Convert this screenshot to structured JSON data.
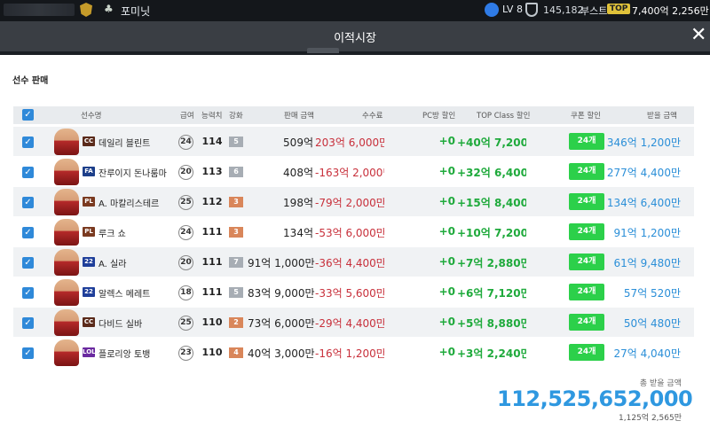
{
  "topbar": {
    "team_name": "포미닛",
    "level": "LV 8",
    "points": "145,182",
    "boost_label": "부스트",
    "top_badge": "TOP",
    "money": "7,400억 2,256만"
  },
  "window": {
    "title": "이적시장"
  },
  "section_title": "선수 판매",
  "columns": {
    "name": "선수명",
    "salary": "급여",
    "ovr": "능력치",
    "enhance": "강화",
    "price": "판매 금액",
    "fee": "수수료",
    "pc_discount": "PC방 할인",
    "topclass_discount": "TOP Class 할인",
    "coupon_discount": "쿠폰 할인",
    "receive": "받을 금액"
  },
  "colors": {
    "accent_blue": "#2f89d9",
    "fee_red": "#c8303b",
    "discount_green": "#1faa3c",
    "coupon_green": "#2cd04a"
  },
  "players": [
    {
      "season": "CC",
      "season_color": "#5a2a1a",
      "name": "데일리 블린트",
      "salary": "24",
      "ovr": "114",
      "enhance": "5",
      "enhance_color": "#a7adb4",
      "price": "509억",
      "fee": "203억 6,000만",
      "pc": "+0",
      "topclass": "+40억 7,200만",
      "coupon": "24개",
      "receive": "346억 1,200만"
    },
    {
      "season": "FA",
      "season_color": "#1d3f8a",
      "name": "잔루이지 돈나룸마",
      "salary": "20",
      "ovr": "113",
      "enhance": "6",
      "enhance_color": "#a7adb4",
      "price": "408억",
      "fee": "-163억 2,000만",
      "pc": "+0",
      "topclass": "+32억 6,400만",
      "coupon": "24개",
      "receive": "277억 4,400만"
    },
    {
      "season": "PL",
      "season_color": "#7a3a20",
      "name": "A. 마칼리스테르",
      "salary": "25",
      "ovr": "112",
      "enhance": "3",
      "enhance_color": "#d9865a",
      "price": "198억",
      "fee": "-79억 2,000만",
      "pc": "+0",
      "topclass": "+15억 8,400만",
      "coupon": "24개",
      "receive": "134억 6,400만"
    },
    {
      "season": "PL",
      "season_color": "#7a3a20",
      "name": "루크 쇼",
      "salary": "24",
      "ovr": "111",
      "enhance": "3",
      "enhance_color": "#d9865a",
      "price": "134억",
      "fee": "-53억 6,000만",
      "pc": "+0",
      "topclass": "+10억 7,200만",
      "coupon": "24개",
      "receive": "91억 1,200만"
    },
    {
      "season": "22",
      "season_color": "#1f3f9a",
      "name": "A. 실라",
      "salary": "20",
      "ovr": "111",
      "enhance": "7",
      "enhance_color": "#a7adb4",
      "price": "91억 1,000만",
      "fee": "-36억 4,400만",
      "pc": "+0",
      "topclass": "+7억 2,880만",
      "coupon": "24개",
      "receive": "61억 9,480만"
    },
    {
      "season": "22",
      "season_color": "#1f3f9a",
      "name": "알렉스 메레트",
      "salary": "18",
      "ovr": "111",
      "enhance": "5",
      "enhance_color": "#a7adb4",
      "price": "83억 9,000만",
      "fee": "-33억 5,600만",
      "pc": "+0",
      "topclass": "+6억 7,120만",
      "coupon": "24개",
      "receive": "57억 520만"
    },
    {
      "season": "CC",
      "season_color": "#5a2a1a",
      "name": "다비드 실바",
      "salary": "25",
      "ovr": "110",
      "enhance": "2",
      "enhance_color": "#d9865a",
      "price": "73억 6,000만",
      "fee": "-29억 4,400만",
      "pc": "+0",
      "topclass": "+5억 8,880만",
      "coupon": "24개",
      "receive": "50억 480만"
    },
    {
      "season": "LOL",
      "season_color": "#6a2aa0",
      "name": "플로리앙 토뱅",
      "salary": "23",
      "ovr": "110",
      "enhance": "4",
      "enhance_color": "#d9865a",
      "price": "40억 3,000만",
      "fee": "-16억 1,200만",
      "pc": "+0",
      "topclass": "+3억 2,240만",
      "coupon": "24개",
      "receive": "27억 4,040만"
    }
  ],
  "total": {
    "label": "총 받을 금액",
    "value": "112,525,652,000",
    "sub": "1,125억 2,565만"
  }
}
